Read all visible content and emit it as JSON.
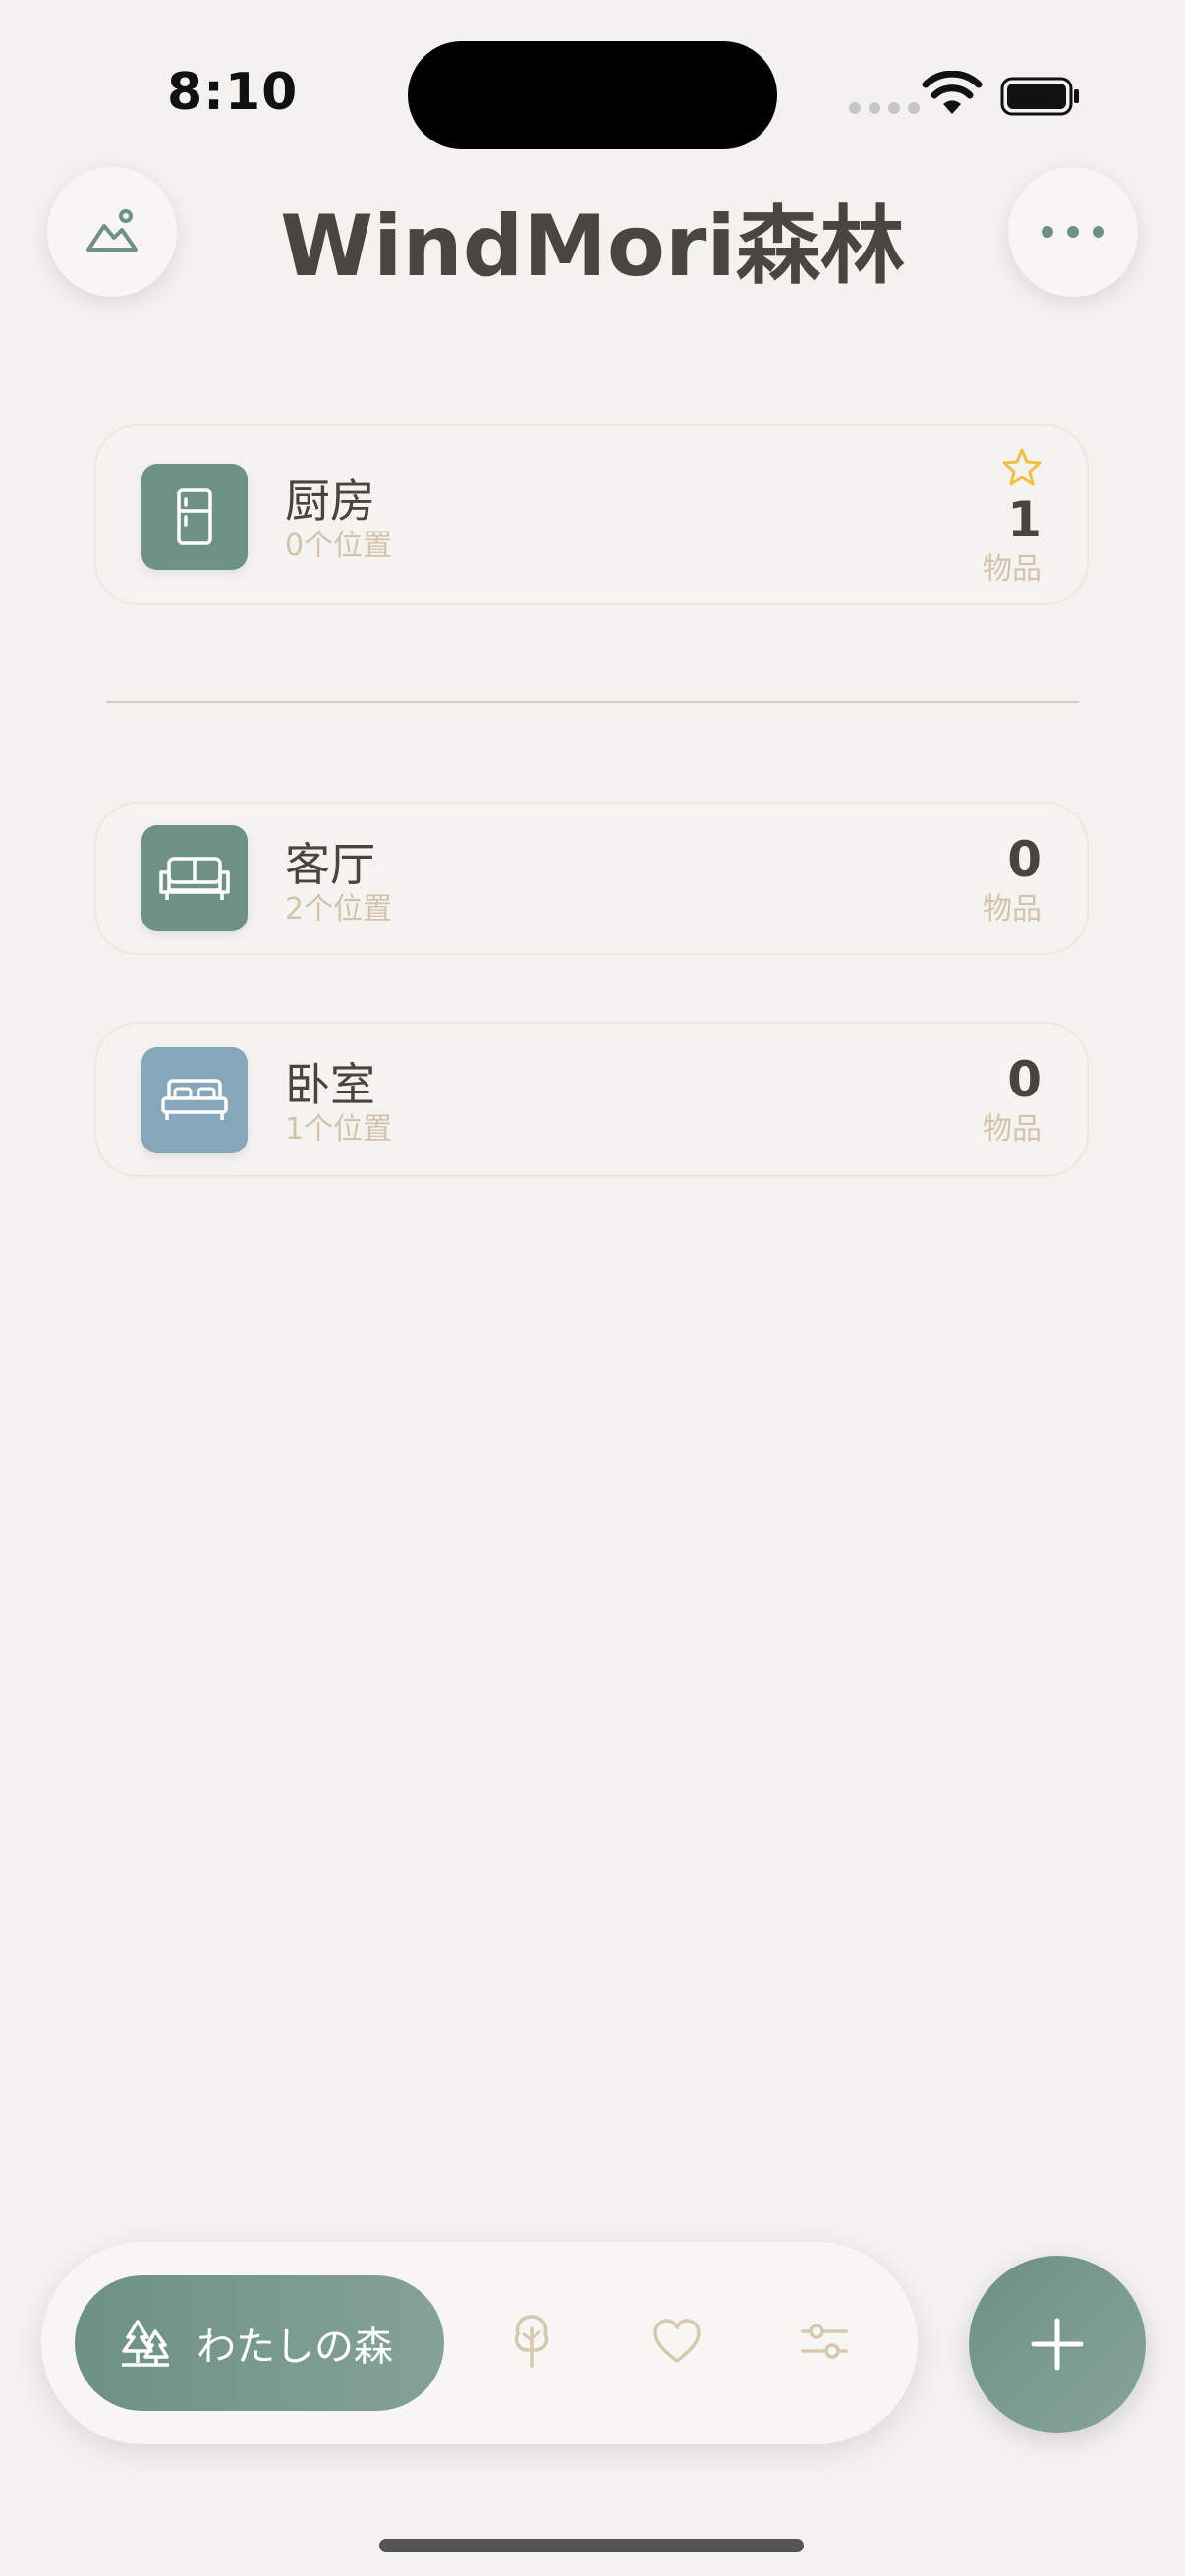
{
  "status_bar": {
    "time": "8:10"
  },
  "header": {
    "title": "WindMori森林"
  },
  "rooms": [
    {
      "name": "厨房",
      "sub": "0个位置",
      "count": "1",
      "count_label": "物品",
      "starred": true,
      "icon": "fridge-icon",
      "color": "#6e9183"
    },
    {
      "name": "客厅",
      "sub": "2个位置",
      "count": "0",
      "count_label": "物品",
      "starred": false,
      "icon": "sofa-icon",
      "color": "#6e9183"
    },
    {
      "name": "卧室",
      "sub": "1个位置",
      "count": "0",
      "count_label": "物品",
      "starred": false,
      "icon": "bed-icon",
      "color": "#86a7ba"
    }
  ],
  "tabbar": {
    "active_label": "わたしの森",
    "tabs": [
      "forest-icon",
      "tree-icon",
      "heart-icon",
      "sliders-icon"
    ]
  },
  "colors": {
    "accent": "#6e9183",
    "muted": "#d3c3ad",
    "star": "#f0c04a",
    "background": "#f4f2ee"
  }
}
